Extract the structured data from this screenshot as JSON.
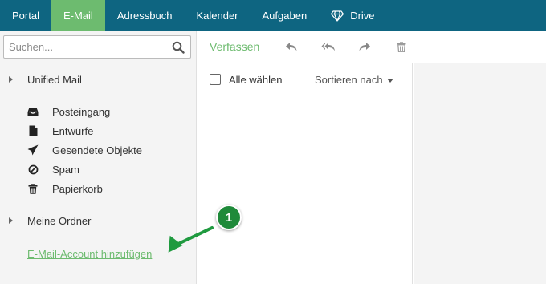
{
  "nav": {
    "tabs": [
      {
        "label": "Portal"
      },
      {
        "label": "E-Mail",
        "active": true
      },
      {
        "label": "Adressbuch"
      },
      {
        "label": "Kalender"
      },
      {
        "label": "Aufgaben"
      },
      {
        "label": "Drive",
        "icon": "diamond-icon"
      }
    ]
  },
  "sidebar": {
    "search_placeholder": "Suchen...",
    "unified_mail": "Unified Mail",
    "folders": [
      {
        "label": "Posteingang",
        "icon": "inbox-icon"
      },
      {
        "label": "Entwürfe",
        "icon": "file-icon"
      },
      {
        "label": "Gesendete Objekte",
        "icon": "paper-plane-icon"
      },
      {
        "label": "Spam",
        "icon": "ban-icon"
      },
      {
        "label": "Papierkorb",
        "icon": "trash-icon"
      }
    ],
    "my_folders": "Meine Ordner",
    "add_account": "E-Mail-Account hinzufügen"
  },
  "toolbar": {
    "compose": "Verfassen",
    "icons": [
      "reply-icon",
      "reply-all-icon",
      "forward-icon",
      "delete-icon"
    ]
  },
  "list": {
    "select_all": "Alle wählen",
    "sort": "Sortieren nach"
  },
  "annotation": {
    "number": "1"
  },
  "colors": {
    "topbar": "#0e6581",
    "accent": "#6dbb6f",
    "badge": "#1f8a3a"
  }
}
